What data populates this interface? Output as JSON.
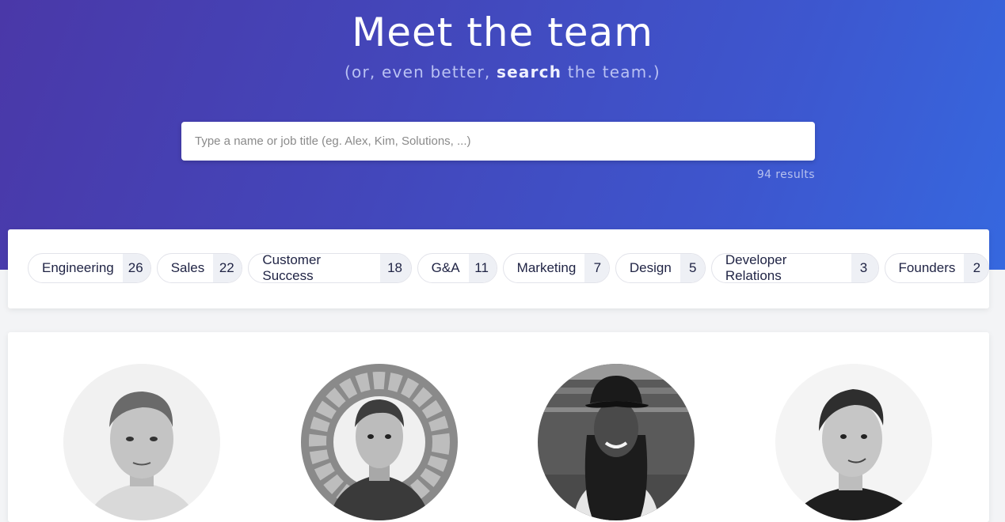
{
  "hero": {
    "title": "Meet the team",
    "subtitle_pre": "(or, even better, ",
    "subtitle_strong": "search",
    "subtitle_post": " the team.)"
  },
  "search": {
    "placeholder": "Type a name or job title (eg. Alex, Kim, Solutions, ...)",
    "value": "",
    "results": "94 results"
  },
  "filters": [
    {
      "label": "Engineering",
      "count": "26"
    },
    {
      "label": "Sales",
      "count": "22"
    },
    {
      "label": "Customer Success",
      "count": "18"
    },
    {
      "label": "G&A",
      "count": "11"
    },
    {
      "label": "Marketing",
      "count": "7"
    },
    {
      "label": "Design",
      "count": "5"
    },
    {
      "label": "Developer Relations",
      "count": "3"
    },
    {
      "label": "Founders",
      "count": "2"
    }
  ],
  "colors": {
    "hero_gradient_start": "#4a38a8",
    "hero_gradient_end": "#3668df",
    "chip_text": "#1f2344",
    "chip_count_bg": "#eef0f5"
  }
}
